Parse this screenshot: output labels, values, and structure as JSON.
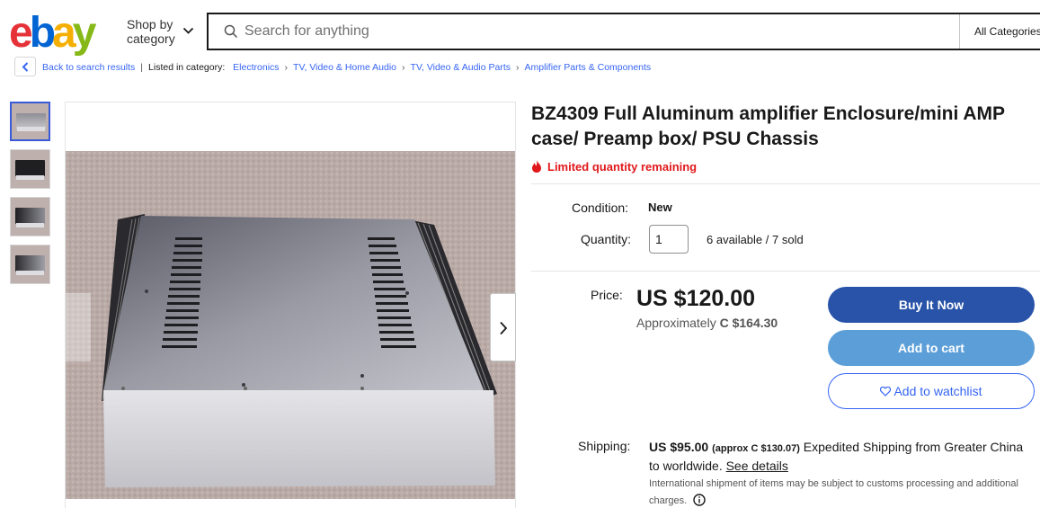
{
  "header": {
    "logo_letters": [
      "e",
      "b",
      "a",
      "y"
    ],
    "logo_colors": [
      "#e53238",
      "#0064d2",
      "#f5af02",
      "#86b817"
    ],
    "shop_by_line1": "Shop by",
    "shop_by_line2": "category",
    "search_placeholder": "Search for anything",
    "category_select": "All Categories"
  },
  "breadcrumb": {
    "back_label": "Back to search results",
    "listed_in": "Listed in category:",
    "items": [
      "Electronics",
      "TV, Video & Home Audio",
      "TV, Video & Audio Parts",
      "Amplifier Parts & Components"
    ]
  },
  "gallery": {
    "thumbnail_count": 4,
    "active_thumbnail": 1
  },
  "listing": {
    "title": "BZ4309 Full Aluminum amplifier Enclosure/mini AMP case/ Preamp box/ PSU Chassis",
    "urgency": "Limited quantity remaining",
    "condition_label": "Condition:",
    "condition_value": "New",
    "quantity_label": "Quantity:",
    "quantity_value": "1",
    "availability": "6 available / 7 sold",
    "price_label": "Price:",
    "price": "US $120.00",
    "approx_prefix": "Approximately",
    "approx_value": "C $164.30",
    "buy_now": "Buy It Now",
    "add_to_cart": "Add to cart",
    "add_to_watchlist": "Add to watchlist"
  },
  "shipping": {
    "label": "Shipping:",
    "amount": "US $95.00",
    "approx": "(approx C $130.07)",
    "method": "Expedited Shipping from Greater China to worldwide.",
    "see_details": "See details",
    "note": "International shipment of items may be subject to customs processing and additional charges."
  },
  "colors": {
    "buy_now_bg": "#2853a8",
    "add_to_cart_bg": "#5c9fd8",
    "link": "#3665f3",
    "urgency": "#e0181b"
  }
}
